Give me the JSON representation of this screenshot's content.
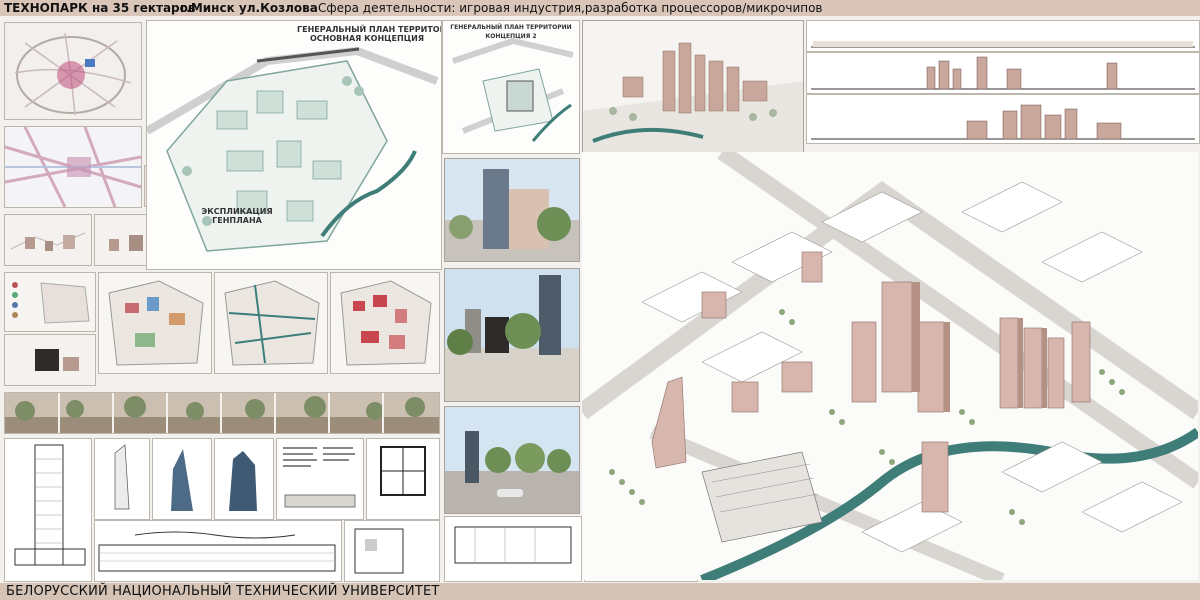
{
  "header": {
    "title_left": "ТЕХНОПАРК на 35 гектаров",
    "title_location": "г.Минск ул.Козлова",
    "title_activity": "Сфера деятельности: игровая индустрия,разработка процессоров/микрочипов"
  },
  "footer": {
    "university": "БЕЛОРУССКИЙ НАЦИОНАЛЬНЫЙ ТЕХНИЧЕСКИЙ УНИВЕРСИТЕТ"
  },
  "plans": {
    "general_plan_title": "ГЕНЕРАЛЬНЫЙ ПЛАН ТЕРРИТОРИИ\nОСНОВНАЯ КОНЦЕПЦИЯ",
    "general_plan_2_title": "ГЕНЕРАЛЬНЫЙ ПЛАН ТЕРРИТОРИИ КОНЦЕПЦИЯ 2",
    "explication_title": "ЭКСПЛИКАЦИЯ ГЕНПЛАНА"
  },
  "colors": {
    "header_band": "#d9c6b8",
    "footer_band": "#d5c3b6",
    "building_pink": "#c9a79c",
    "plan_green": "#7fa79a",
    "water": "#3f7d78"
  }
}
